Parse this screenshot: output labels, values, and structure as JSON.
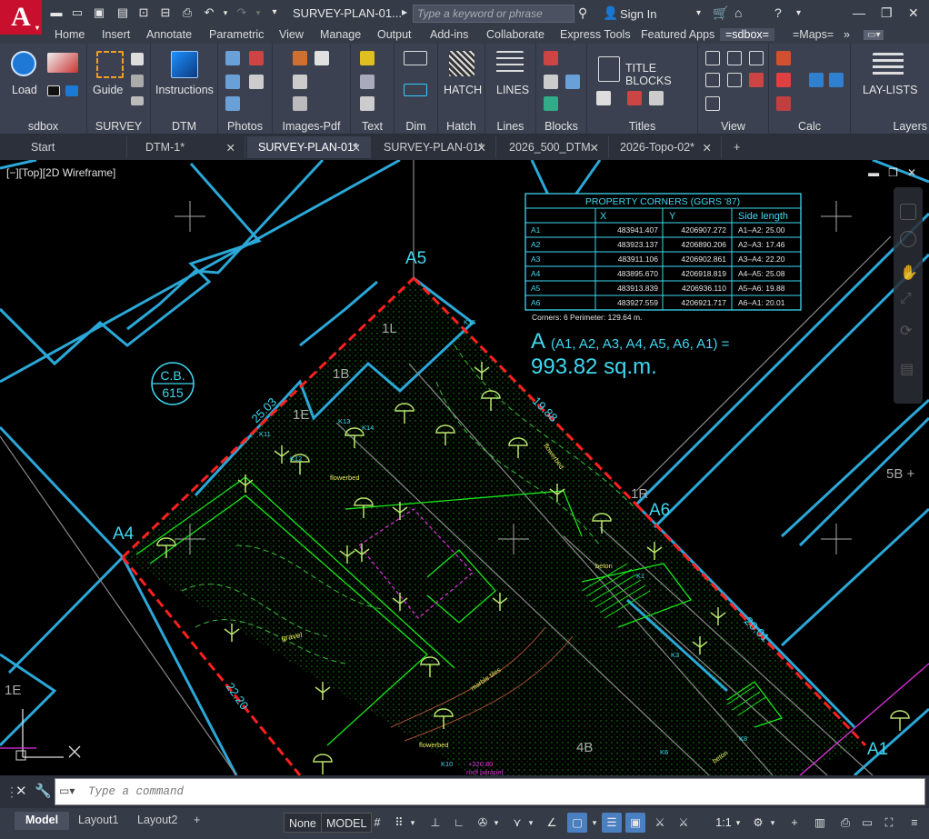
{
  "app": {
    "logo_letter": "A",
    "document_title": "SURVEY-PLAN-01...",
    "search_placeholder": "Type a keyword or phrase",
    "sign_in": "Sign In"
  },
  "ribbon_tabs": [
    "Home",
    "Insert",
    "Annotate",
    "Parametric",
    "View",
    "Manage",
    "Output",
    "Add-ins",
    "Collaborate",
    "Express Tools",
    "Featured Apps",
    "=sdbox=",
    "=Maps="
  ],
  "ribbon": {
    "load": "Load",
    "guide": "Guide",
    "instructions": "Instructions",
    "hatch": "HATCH",
    "lines": "LINES",
    "title_blocks": "TITLE BLOCKS",
    "lay_lists": "LAY-LISTS",
    "panels": [
      "sdbox",
      "SURVEY",
      "DTM",
      "Photos",
      "Images-Pdf",
      "Text",
      "Dim",
      "Hatch",
      "Lines",
      "Blocks",
      "Titles",
      "View",
      "Calc",
      "Layers"
    ]
  },
  "doc_tabs": [
    "Start",
    "DTM-1*",
    "SURVEY-PLAN-01*",
    "SURVEY-PLAN-01*",
    "2026_500_DTM",
    "2026-Topo-02*"
  ],
  "viewport_label": "[−][Top][2D Wireframe]",
  "drawing": {
    "corner_labels": [
      "A5",
      "A4",
      "A6",
      "A1"
    ],
    "parcel_labels": [
      "1L",
      "1B",
      "1E",
      "1R",
      "5B +",
      "4B",
      "1E"
    ],
    "building_tag": [
      "C.B.",
      "615"
    ],
    "side_lengths": [
      "25.03",
      "19.88",
      "20.01",
      "22.20"
    ],
    "annotations": [
      "flowerbed",
      "flowerbed",
      "gravel",
      "marble tiles",
      "beton",
      "beton",
      "flowerbed",
      "roof  parapet",
      "+220.80",
      "K15",
      "K13",
      "K14",
      "K11",
      "K12",
      "K1",
      "K3",
      "K6",
      "K10",
      "K8"
    ]
  },
  "property_table": {
    "title": "PROPERTY CORNERS  (GGRS '87)",
    "headers": [
      "",
      "X",
      "Y",
      "Side length"
    ],
    "rows": [
      [
        "A1",
        "483941.407",
        "4206907.272",
        "A1–A2: 25.00"
      ],
      [
        "A2",
        "483923.137",
        "4206890.206",
        "A2–A3: 17.46"
      ],
      [
        "A3",
        "483911.106",
        "4206902.861",
        "A3–A4: 22.20"
      ],
      [
        "A4",
        "483895.670",
        "4206918.819",
        "A4–A5: 25.08"
      ],
      [
        "A5",
        "483913.839",
        "4206936.110",
        "A5–A6: 19.88"
      ],
      [
        "A6",
        "483927.559",
        "4206921.717",
        "A6–A1: 20.01"
      ]
    ],
    "footer": "Corners:  6     Perimeter:  129.64 m."
  },
  "area_label": {
    "symbol": "A",
    "formula": "(A1, A2, A3, A4, A5, A6, A1) =",
    "value": "993.82 sq.m."
  },
  "command": {
    "placeholder": "Type  a  command"
  },
  "status": {
    "layout_tabs": [
      "Model",
      "Layout1",
      "Layout2"
    ],
    "none": "None",
    "model": "MODEL",
    "scale": "1:1"
  },
  "colors": {
    "accent_cyan": "#3fd8f0",
    "boundary_red": "#ff2020",
    "wall_blue": "#2ba8d8",
    "green": "#19e619",
    "magenta": "#e030e0"
  }
}
